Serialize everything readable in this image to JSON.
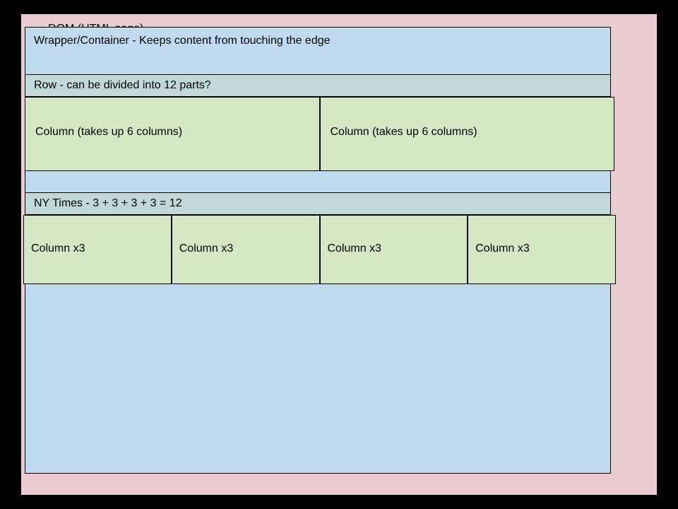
{
  "dom": {
    "label": "DOM (HTML page)"
  },
  "wrapper": {
    "label": "Wrapper/Container - Keeps content from touching the edge"
  },
  "row1": {
    "header": "Row - can be divided into 12 parts?",
    "columns": [
      "Column (takes up 6 columns)",
      "Column (takes up 6 columns)"
    ]
  },
  "row2": {
    "header": "NY Times - 3 + 3 + 3 + 3 = 12",
    "columns": [
      "Column x3",
      "Column x3",
      "Column x3",
      "Column x3"
    ]
  }
}
